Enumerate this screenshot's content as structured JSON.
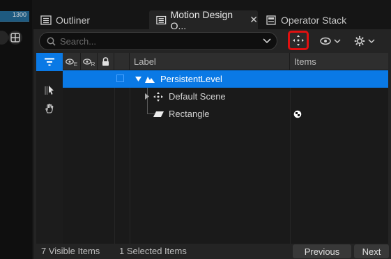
{
  "viewport": {
    "ruler_value": "1300"
  },
  "tabs": [
    {
      "label": "Outliner",
      "icon": "outliner-icon"
    },
    {
      "label": "Motion Design O...",
      "icon": "outliner-icon",
      "close": "✕"
    },
    {
      "label": "Operator Stack",
      "icon": "stack-icon"
    }
  ],
  "search": {
    "placeholder": "Search..."
  },
  "columns": {
    "label": "Label",
    "items": "Items",
    "eye_e": "E",
    "eye_r": "R"
  },
  "rows": [
    {
      "label": "PersistentLevel",
      "selected": true
    },
    {
      "label": "Default Scene"
    },
    {
      "label": "Rectangle"
    }
  ],
  "status": {
    "visible": "7 Visible Items",
    "selected": "1 Selected Items",
    "previous": "Previous",
    "next": "Next"
  },
  "colors": {
    "accent": "#0a79e5",
    "highlight": "#e01010"
  }
}
